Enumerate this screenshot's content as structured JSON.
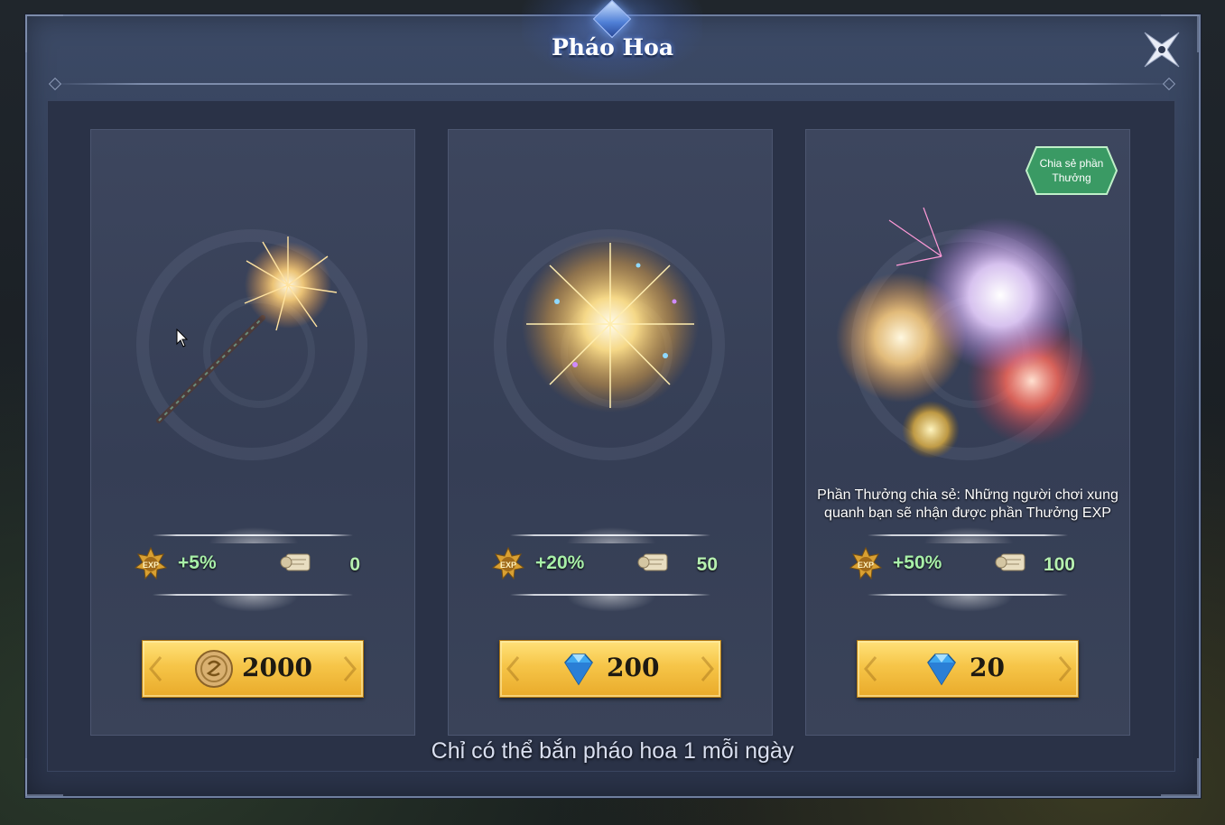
{
  "window": {
    "title": "Pháo Hoa",
    "close_icon": "close-x-icon"
  },
  "colors": {
    "panel": "#2e3850",
    "card": "#3a4359",
    "button_gold": "#f6c548",
    "stat_green": "#a8f0a8",
    "badge_green": "#3aa06a"
  },
  "cards": [
    {
      "art_icon": "sparkler-icon",
      "exp_bonus": "+5%",
      "exp_icon": "exp-medal-icon",
      "scroll_icon": "scroll-icon",
      "scroll_count": "0",
      "price_icon": "gold-coin-icon",
      "price": "2000"
    },
    {
      "art_icon": "firework-burst-icon",
      "exp_bonus": "+20%",
      "exp_icon": "exp-medal-icon",
      "scroll_icon": "scroll-icon",
      "scroll_count": "50",
      "price_icon": "diamond-icon",
      "price": "200"
    },
    {
      "art_icon": "firework-cluster-icon",
      "badge": "Chia sẻ phần Thưởng",
      "share_description": "Phần Thưởng chia sẻ: Những người chơi xung quanh bạn sẽ nhận được phần Thưởng EXP",
      "exp_bonus": "+50%",
      "exp_icon": "exp-medal-icon",
      "scroll_icon": "scroll-icon",
      "scroll_count": "100",
      "price_icon": "diamond-icon",
      "price": "20"
    }
  ],
  "footer_note": "Chỉ có thể bắn pháo hoa 1 mỗi ngày"
}
